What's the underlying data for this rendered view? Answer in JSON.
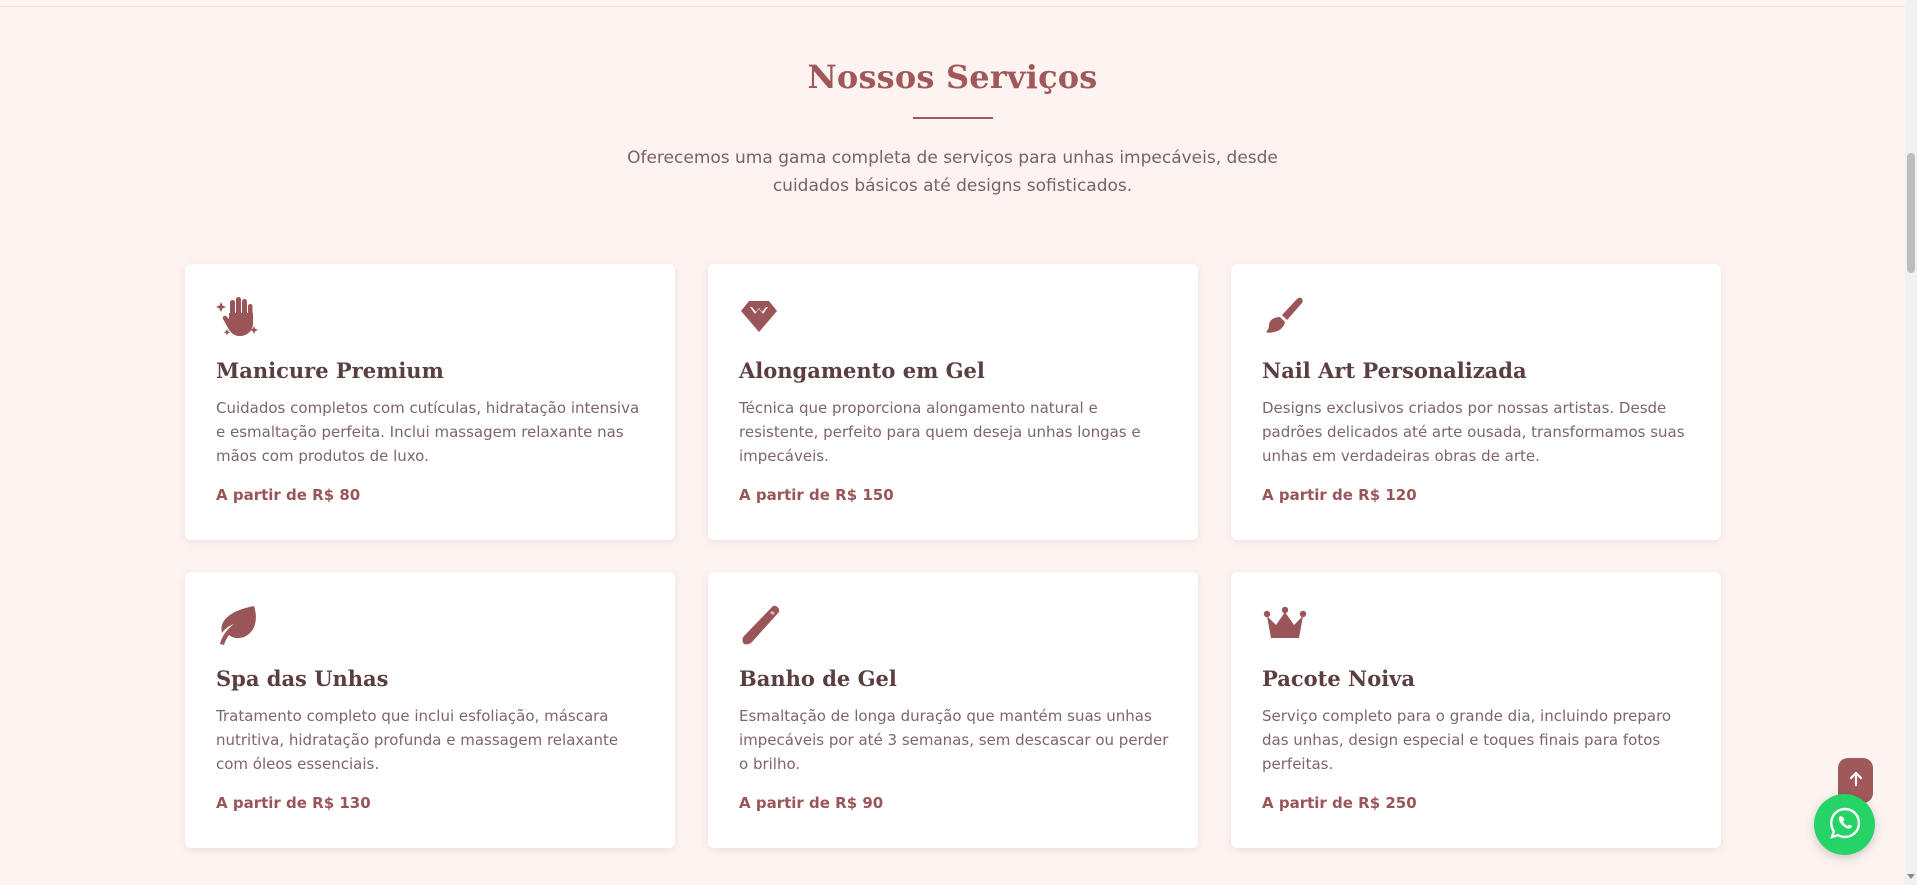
{
  "section": {
    "title": "Nossos Serviços",
    "subtitle": "Oferecemos uma gama completa de serviços para unhas impecáveis, desde cuidados básicos até designs sofisticados."
  },
  "services": [
    {
      "icon": "hand-sparkles-icon",
      "title": "Manicure Premium",
      "description": "Cuidados completos com cutículas, hidratação intensiva e esmaltação perfeita. Inclui massagem relaxante nas mãos com produtos de luxo.",
      "price": "A partir de R$ 80"
    },
    {
      "icon": "gem-icon",
      "title": "Alongamento em Gel",
      "description": "Técnica que proporciona alongamento natural e resistente, perfeito para quem deseja unhas longas e impecáveis.",
      "price": "A partir de R$ 150"
    },
    {
      "icon": "paintbrush-icon",
      "title": "Nail Art Personalizada",
      "description": "Designs exclusivos criados por nossas artistas. Desde padrões delicados até arte ousada, transformamos suas unhas em verdadeiras obras de arte.",
      "price": "A partir de R$ 120"
    },
    {
      "icon": "leaf-icon",
      "title": "Spa das Unhas",
      "description": "Tratamento completo que inclui esfoliação, máscara nutritiva, hidratação profunda e massagem relaxante com óleos essenciais.",
      "price": "A partir de R$ 130"
    },
    {
      "icon": "nail-file-icon",
      "title": "Banho de Gel",
      "description": "Esmaltação de longa duração que mantém suas unhas impecáveis por até 3 semanas, sem descascar ou perder o brilho.",
      "price": "A partir de R$ 90"
    },
    {
      "icon": "crown-icon",
      "title": "Pacote Noiva",
      "description": "Serviço completo para o grande dia, incluindo preparo das unhas, design especial e toques finais para fotos perfeitas.",
      "price": "A partir de R$ 250"
    }
  ],
  "floating": {
    "back_to_top_icon": "arrow-up-icon",
    "whatsapp_icon": "whatsapp-icon"
  },
  "colors": {
    "background": "#fdf3f1",
    "accent": "#a0585b",
    "card": "#ffffff",
    "whatsapp": "#25d366"
  }
}
